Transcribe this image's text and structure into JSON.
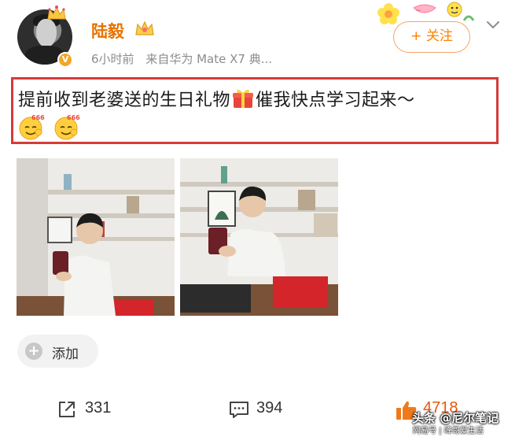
{
  "user": {
    "name": "陆毅",
    "avatar_icon": "user-avatar-photo",
    "verified_icon": "v-verified-badge",
    "vip_icon": "crown-icon"
  },
  "post_meta": {
    "time": "6小时前",
    "source": "来自华为 Mate X7 典..."
  },
  "follow_button": {
    "label": "+ 关注"
  },
  "post": {
    "text_before_gift": "提前收到老婆送的生日礼物",
    "gift_icon": "gift-icon",
    "text_after_gift": "催我快点学习起来～",
    "emojis": [
      "666-emoji",
      "666-emoji"
    ]
  },
  "photos": [
    {
      "icon": "photo-man-with-phone"
    },
    {
      "icon": "photo-man-with-phone-closeup"
    }
  ],
  "add_button": {
    "label": "添加"
  },
  "actions": {
    "share_count": "331",
    "comment_count": "394",
    "like_count": "4718"
  },
  "watermark": {
    "main": "头条 @尼尔笔记",
    "sub": "网易号 | 峰哥爱生活"
  },
  "colors": {
    "username": "#e77300",
    "follow": "#ff8200",
    "highlight_border": "#d63a3a",
    "like": "#e8560a"
  }
}
